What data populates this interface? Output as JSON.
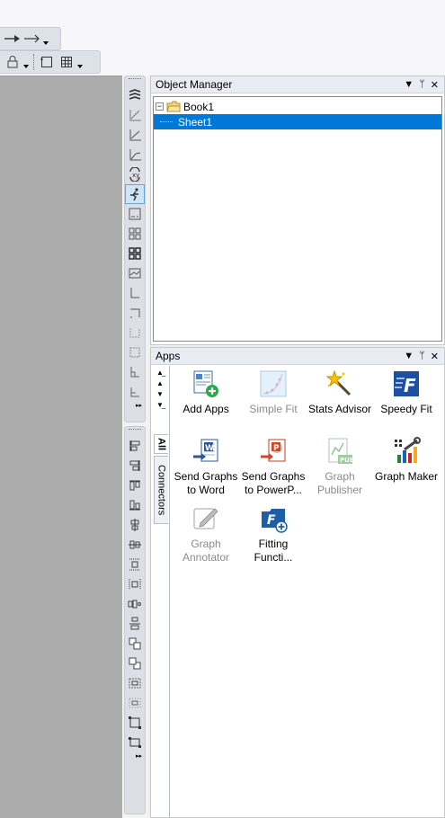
{
  "object_manager": {
    "title": "Object Manager",
    "tree": [
      {
        "label": "Book1",
        "level": 0,
        "selected": false
      },
      {
        "label": "Sheet1",
        "level": 1,
        "selected": true
      }
    ]
  },
  "apps_panel": {
    "title": "Apps",
    "tabs": [
      "All",
      "Connectors"
    ],
    "items": [
      {
        "label": "Add Apps",
        "enabled": true
      },
      {
        "label": "Simple Fit",
        "enabled": false
      },
      {
        "label": "Stats Advisor",
        "enabled": true
      },
      {
        "label": "Speedy Fit",
        "enabled": true
      },
      {
        "label": "Send Graphs to Word",
        "enabled": true
      },
      {
        "label": "Send Graphs to PowerP...",
        "enabled": true
      },
      {
        "label": "Graph Publisher",
        "enabled": false
      },
      {
        "label": "Graph Maker",
        "enabled": true
      },
      {
        "label": "Graph Annotator",
        "enabled": false
      },
      {
        "label": "Fitting Functi...",
        "enabled": true
      }
    ]
  },
  "colors": {
    "selection": "#0078d7",
    "workspace": "#ababab",
    "panel_header": "#e9ecf2"
  }
}
